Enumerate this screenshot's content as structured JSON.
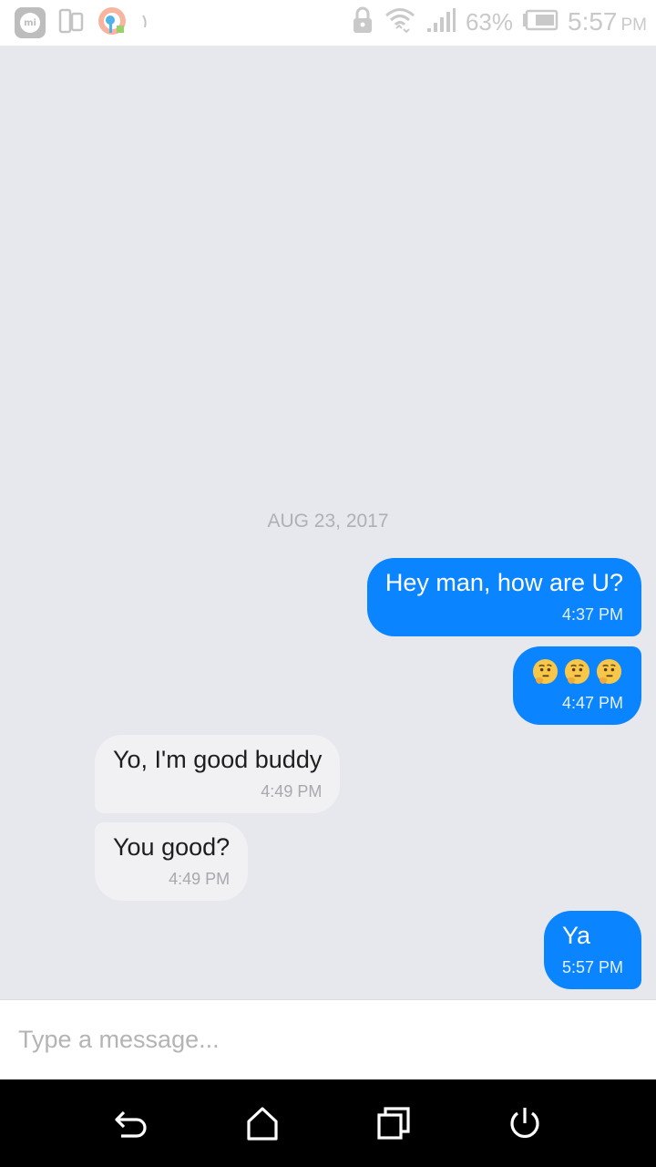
{
  "status_bar": {
    "battery_percent": "63%",
    "time": "5:57",
    "ampm": "PM",
    "icons": [
      "mi-icon",
      "dual-window-icon",
      "browser-icon",
      "signal-fragment-icon",
      "lock-icon",
      "wifi-icon",
      "cell-signal-icon",
      "battery-icon"
    ]
  },
  "chat": {
    "date": "AUG 23, 2017",
    "messages": [
      {
        "direction": "outgoing",
        "text": "Hey man, how are U?",
        "time": "4:37 PM"
      },
      {
        "direction": "outgoing",
        "text": "🤔🤔🤔",
        "emoji": [
          "thinking-face",
          "thinking-face",
          "thinking-face"
        ],
        "time": "4:47 PM"
      },
      {
        "direction": "incoming",
        "text": "Yo, I'm good buddy",
        "time": "4:49 PM"
      },
      {
        "direction": "incoming",
        "text": "You good?",
        "time": "4:49 PM"
      },
      {
        "direction": "outgoing",
        "text": "Ya",
        "time": "5:57 PM"
      }
    ]
  },
  "composer": {
    "placeholder": "Type a message...",
    "value": ""
  },
  "nav_bar": {
    "icons": [
      "back-icon",
      "home-icon",
      "recents-icon",
      "power-icon"
    ]
  },
  "colors": {
    "outgoing_bubble": "#0a84ff",
    "incoming_bubble": "#f1f1f3",
    "chat_background": "#e6e8ee"
  }
}
